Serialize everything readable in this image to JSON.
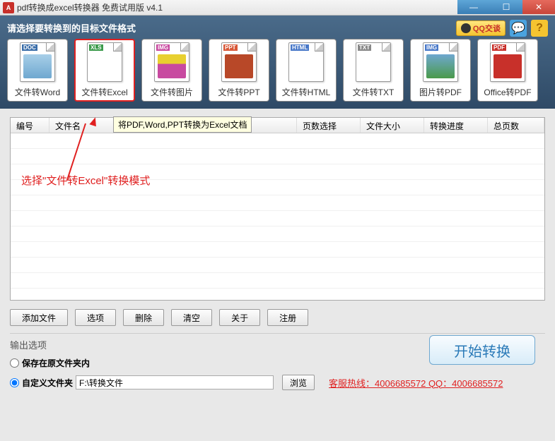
{
  "window": {
    "title": "pdf转换成excel转换器 免费试用版 v4.1",
    "icon_text": "A"
  },
  "top": {
    "prompt": "请选择要转换到的目标文件格式",
    "qq_label": "QQ交谈"
  },
  "formats": [
    {
      "tag": "DOC",
      "tag_bg": "#3a6da8",
      "label": "文件转Word",
      "body_style": "background:linear-gradient(#a8cfe8,#6fa8d0);"
    },
    {
      "tag": "XLS",
      "tag_bg": "#3a9a4a",
      "label": "文件转Excel",
      "body_style": "background:#fff;",
      "selected": true
    },
    {
      "tag": "IMG",
      "tag_bg": "#c84aa0",
      "label": "文件转图片",
      "body_style": "background:linear-gradient(#e8d030 40%,#c84aa0 40%);"
    },
    {
      "tag": "PPT",
      "tag_bg": "#d85838",
      "label": "文件转PPT",
      "body_style": "background:#b84828;"
    },
    {
      "tag": "HTML",
      "tag_bg": "#4878c8",
      "label": "文件转HTML",
      "body_style": "background:#fff;"
    },
    {
      "tag": "TXT",
      "tag_bg": "#888",
      "label": "文件转TXT",
      "body_style": "background:#fff;"
    },
    {
      "tag": "IMG",
      "tag_bg": "#4878c8",
      "label": "图片转PDF",
      "body_style": "background:linear-gradient(#6fa8d0,#4a9a4a);"
    },
    {
      "tag": "PDF",
      "tag_bg": "#c8302a",
      "label": "Office转PDF",
      "body_style": "background:#c8302a;"
    }
  ],
  "tooltip": "将PDF,Word,PPT转换为Excel文档",
  "annotation": "选择\"文件转Excel\"转换模式",
  "table": {
    "headers": [
      "编号",
      "文件名",
      "页数选择",
      "文件大小",
      "转换进度",
      "总页数"
    ],
    "row_count": 11
  },
  "buttons": {
    "add": "添加文件",
    "options": "选项",
    "delete": "删除",
    "clear": "清空",
    "about": "关于",
    "register": "注册"
  },
  "output": {
    "title": "输出选项",
    "opt_source": "保存在原文件夹内",
    "opt_custom": "自定义文件夹",
    "path": "F:\\转换文件",
    "browse": "浏览",
    "hotline": "客服热线：4006685572 QQ：4006685572",
    "start": "开始转换"
  }
}
